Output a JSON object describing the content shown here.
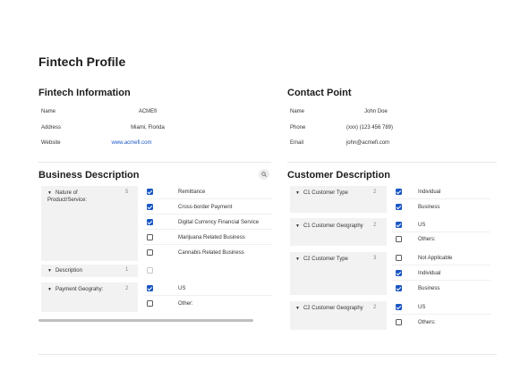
{
  "page_title": "Fintech Profile",
  "fintech_info": {
    "title": "Fintech Information",
    "rows": [
      {
        "label": "Name",
        "value": "ACMEfi"
      },
      {
        "label": "Address",
        "value": "Miami, Florida"
      },
      {
        "label": "Website",
        "value": "www.acmefi.com"
      }
    ]
  },
  "contact_point": {
    "title": "Contact Point",
    "rows": [
      {
        "label": "Name",
        "value": "John Doe"
      },
      {
        "label": "Phone",
        "value": "(xxx) (123 456 789)"
      },
      {
        "label": "Email",
        "value": "john@acmefi.com"
      }
    ]
  },
  "business_description": {
    "title": "Business Description",
    "search_icon": "search-icon",
    "groups": [
      {
        "label": "Nature of Product/Service:",
        "count": "5",
        "options": [
          {
            "label": "Remittance",
            "checked": true
          },
          {
            "label": "Cross-border Payment",
            "checked": true
          },
          {
            "label": "Digital Currency Financial Service",
            "checked": true
          },
          {
            "label": "Marijuana Related Business",
            "checked": false
          },
          {
            "label": "Cannabis Related Business",
            "checked": false
          }
        ]
      },
      {
        "label": "Description",
        "count": "1",
        "options": [
          {
            "label": "",
            "checked": false
          }
        ]
      },
      {
        "label": "Payment Geograhy:",
        "count": "2",
        "options": [
          {
            "label": "US",
            "checked": true
          },
          {
            "label": "Other:",
            "checked": false
          }
        ]
      }
    ]
  },
  "customer_description": {
    "title": "Customer Description",
    "groups": [
      {
        "label": "C1 Customer Type",
        "count": "2",
        "options": [
          {
            "label": "Individual",
            "checked": true
          },
          {
            "label": "Business",
            "checked": true
          }
        ]
      },
      {
        "label": "C1 Customer Geography",
        "count": "2",
        "options": [
          {
            "label": "US",
            "checked": true
          },
          {
            "label": "Others:",
            "checked": false
          }
        ]
      },
      {
        "label": "C2 Customer Type",
        "count": "3",
        "options": [
          {
            "label": "Not Applicable",
            "checked": false
          },
          {
            "label": "Individual",
            "checked": true
          },
          {
            "label": "Business",
            "checked": true
          }
        ]
      },
      {
        "label": "C2 Customer Geography",
        "count": "2",
        "options": [
          {
            "label": "US",
            "checked": true
          },
          {
            "label": "Others:",
            "checked": false
          }
        ]
      }
    ]
  },
  "colors": {
    "accent": "#1a56c4",
    "group_bg": "#f2f2f2"
  }
}
